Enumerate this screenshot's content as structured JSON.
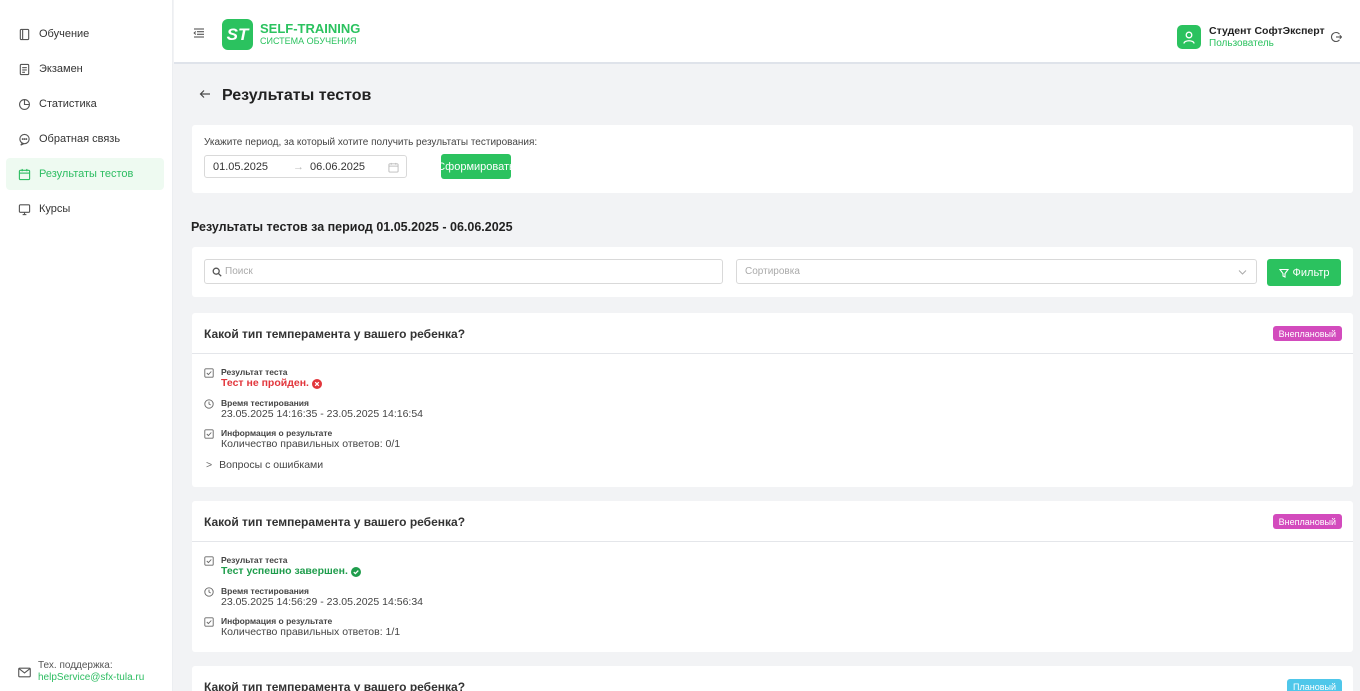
{
  "sidebar": {
    "items": [
      {
        "label": "Обучение",
        "icon": "book-icon"
      },
      {
        "label": "Экзамен",
        "icon": "exam-icon"
      },
      {
        "label": "Статистика",
        "icon": "pie-chart-icon"
      },
      {
        "label": "Обратная связь",
        "icon": "chat-icon"
      },
      {
        "label": "Результаты тестов",
        "icon": "calendar-icon",
        "active": true
      },
      {
        "label": "Курсы",
        "icon": "screen-icon"
      }
    ],
    "support_label": "Тех. поддержка:",
    "support_email": "helpService@sfx-tula.ru"
  },
  "header": {
    "logo_text": "ST",
    "brand_title": "SELF-TRAINING",
    "brand_subtitle": "СИСТЕМА ОБУЧЕНИЯ",
    "user_name": "Студент СофтЭксперт",
    "user_role": "Пользователь"
  },
  "page": {
    "title": "Результаты тестов",
    "period_hint": "Укажите период, за который хотите получить результаты тестирования:",
    "date_from": "01.05.2025",
    "date_to": "06.06.2025",
    "date_arrow": "→",
    "generate_label": "Сформировать",
    "results_title": "Результаты тестов за период 01.05.2025 - 06.06.2025",
    "search_placeholder": "Поиск",
    "sort_placeholder": "Сортировка",
    "filter_label": "Фильтр"
  },
  "labels": {
    "result": "Результат теста",
    "time": "Время тестирования",
    "info": "Информация о результате",
    "errors": "Вопросы с ошибками"
  },
  "results": [
    {
      "question": "Какой тип темперамента у вашего ребенка?",
      "badge": "Внеплановый",
      "status": "Тест не пройден.",
      "passed": false,
      "time": "23.05.2025 14:16:35 - 23.05.2025 14:16:54",
      "correct": "Количество правильных ответов: 0/1"
    },
    {
      "question": "Какой тип темперамента у вашего ребенка?",
      "badge": "Внеплановый",
      "status": "Тест успешно завершен.",
      "passed": true,
      "time": "23.05.2025 14:56:29 - 23.05.2025 14:56:34",
      "correct": "Количество правильных ответов: 1/1"
    },
    {
      "question": "Какой тип темперамента у вашего ребенка?",
      "badge": "Плановый"
    }
  ],
  "colors": {
    "accent": "#2bc25f",
    "fail": "#e2363c",
    "success": "#1f9d4c",
    "badge_unplanned": "#d34bbd",
    "badge_planned": "#4fc7ea"
  }
}
